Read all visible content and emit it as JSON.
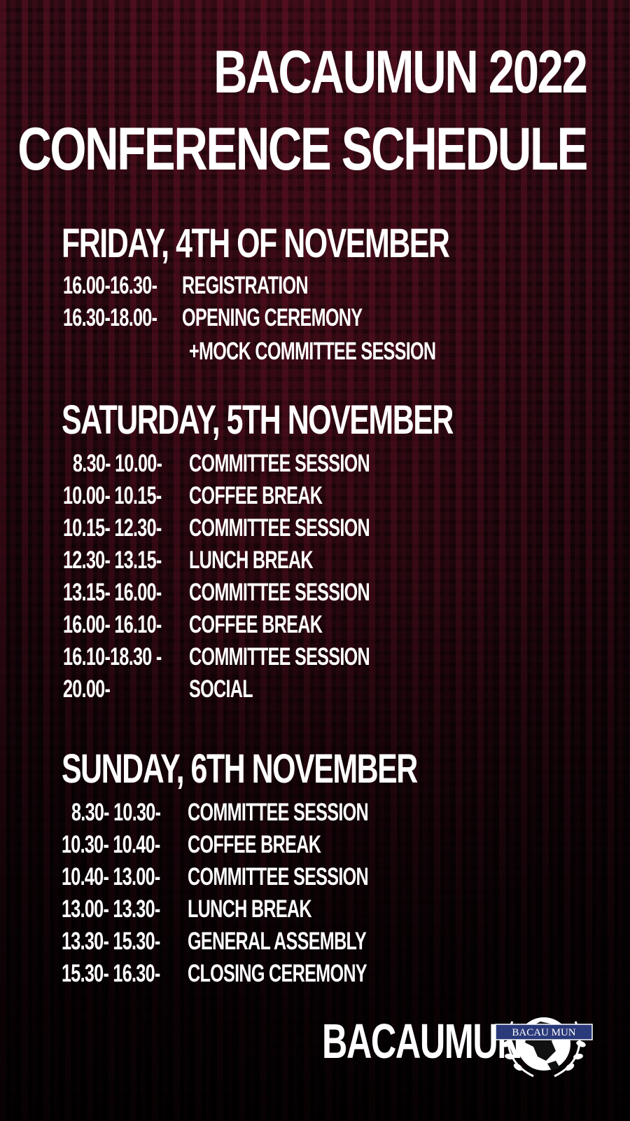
{
  "title": {
    "line1": "BACAUMUN 2022",
    "line2": "CONFERENCE SCHEDULE"
  },
  "days": [
    {
      "heading": "FRIDAY, 4TH OF NOVEMBER",
      "items": [
        {
          "time": "16.00-16.30-",
          "activity": "REGISTRATION"
        },
        {
          "time": "16.30-18.00-",
          "activity": "OPENING CEREMONY"
        },
        {
          "time": "",
          "activity": "+MOCK COMMITTEE SESSION"
        }
      ]
    },
    {
      "heading": "SATURDAY, 5TH NOVEMBER",
      "items": [
        {
          "time": "8.30- 10.00-",
          "activity": "COMMITTEE SESSION"
        },
        {
          "time": "10.00- 10.15-",
          "activity": "COFFEE BREAK"
        },
        {
          "time": "10.15- 12.30-",
          "activity": "COMMITTEE SESSION"
        },
        {
          "time": "12.30- 13.15-",
          "activity": "LUNCH BREAK"
        },
        {
          "time": "13.15- 16.00-",
          "activity": "COMMITTEE SESSION"
        },
        {
          "time": "16.00- 16.10-",
          "activity": "COFFEE BREAK"
        },
        {
          "time": "16.10-18.30 -",
          "activity": "COMMITTEE SESSION"
        },
        {
          "time": "20.00-",
          "activity": "SOCIAL"
        }
      ]
    },
    {
      "heading": "SUNDAY, 6TH NOVEMBER",
      "items": [
        {
          "time": "8.30- 10.30-",
          "activity": "COMMITTEE SESSION"
        },
        {
          "time": "10.30- 10.40-",
          "activity": "COFFEE BREAK"
        },
        {
          "time": "10.40- 13.00-",
          "activity": "COMMITTEE SESSION"
        },
        {
          "time": "13.00- 13.30-",
          "activity": "LUNCH BREAK"
        },
        {
          "time": "13.30- 15.30-",
          "activity": "GENERAL ASSEMBLY"
        },
        {
          "time": "15.30- 16.30-",
          "activity": "CLOSING CEREMONY"
        }
      ]
    }
  ],
  "footer": {
    "brand": "BACAUMUN",
    "logo_text": "BACAU MUN"
  },
  "colors": {
    "background": "#1a060b",
    "matrix_glyphs": "#96193a",
    "text": "#ffffff",
    "logo_ribbon": "#2a3a7a"
  }
}
